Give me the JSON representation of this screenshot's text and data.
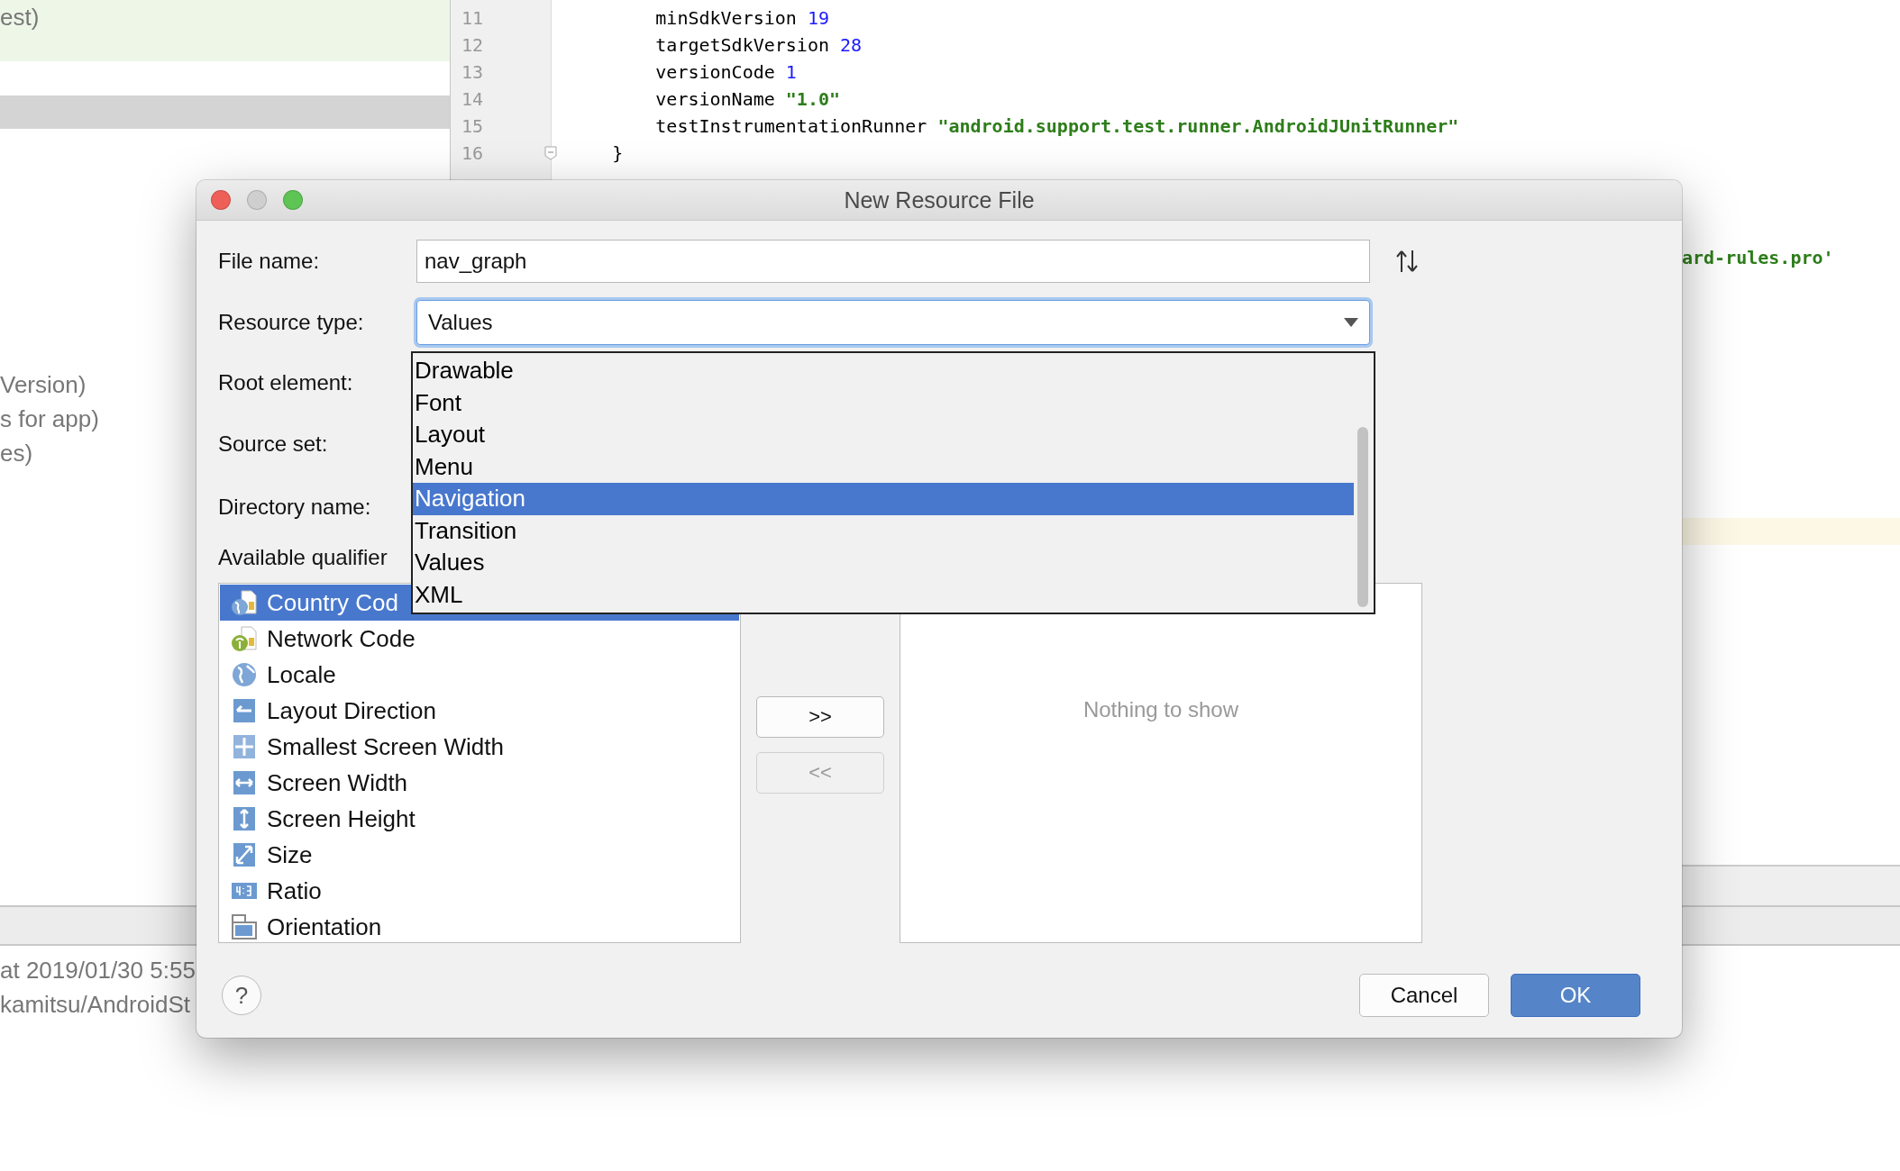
{
  "background": {
    "left_panel": {
      "highlighted_line": "est)",
      "lines": [
        "Version)",
        "s for app)",
        "es)"
      ],
      "status_lines": [
        "at 2019/01/30 5:55",
        "kamitsu/AndroidSt"
      ]
    },
    "editor": {
      "lines": [
        {
          "number": "11",
          "tokens": [
            {
              "text": "        minSdkVersion ",
              "kind": "plain"
            },
            {
              "text": "19",
              "kind": "number"
            }
          ]
        },
        {
          "number": "12",
          "tokens": [
            {
              "text": "        targetSdkVersion ",
              "kind": "plain"
            },
            {
              "text": "28",
              "kind": "number"
            }
          ]
        },
        {
          "number": "13",
          "tokens": [
            {
              "text": "        versionCode ",
              "kind": "plain"
            },
            {
              "text": "1",
              "kind": "number"
            }
          ]
        },
        {
          "number": "14",
          "tokens": [
            {
              "text": "        versionName ",
              "kind": "plain"
            },
            {
              "text": "\"1.0\"",
              "kind": "string"
            }
          ]
        },
        {
          "number": "15",
          "tokens": [
            {
              "text": "        testInstrumentationRunner ",
              "kind": "plain"
            },
            {
              "text": "\"android.support.test.runner.AndroidJUnitRunner\"",
              "kind": "string"
            }
          ]
        },
        {
          "number": "16",
          "fold_marker": true,
          "tokens": [
            {
              "text": "    }",
              "kind": "plain"
            }
          ]
        }
      ],
      "right_fragment": "ard-rules.pro'"
    }
  },
  "dialog": {
    "title": "New Resource File",
    "window_controls": [
      {
        "kind": "close",
        "enabled": true
      },
      {
        "kind": "minimize",
        "enabled": false
      },
      {
        "kind": "zoom",
        "enabled": true
      }
    ],
    "file_name": {
      "label": "File name:",
      "value": "nav_graph"
    },
    "resource_type": {
      "label": "Resource type:",
      "value": "Values",
      "expanded": true
    },
    "labels": [
      "Root element:",
      "Source set:",
      "Directory name:",
      "Available qualifier"
    ],
    "dropdown": {
      "items": [
        {
          "label": "Drawable",
          "selected": false
        },
        {
          "label": "Font",
          "selected": false
        },
        {
          "label": "Layout",
          "selected": false
        },
        {
          "label": "Menu",
          "selected": false
        },
        {
          "label": "Navigation",
          "selected": true
        },
        {
          "label": "Transition",
          "selected": false
        },
        {
          "label": "Values",
          "selected": false
        },
        {
          "label": "XML",
          "selected": false
        }
      ]
    },
    "qualifiers": [
      {
        "label": "Country Cod",
        "kind": "country",
        "selected": true
      },
      {
        "label": "Network Code",
        "kind": "network",
        "selected": false
      },
      {
        "label": "Locale",
        "kind": "locale",
        "selected": false
      },
      {
        "label": "Layout Direction",
        "kind": "direction",
        "selected": false
      },
      {
        "label": "Smallest Screen Width",
        "kind": "smallest",
        "selected": false
      },
      {
        "label": "Screen Width",
        "kind": "width",
        "selected": false
      },
      {
        "label": "Screen Height",
        "kind": "height",
        "selected": false
      },
      {
        "label": "Size",
        "kind": "size",
        "selected": false
      },
      {
        "label": "Ratio",
        "kind": "ratio",
        "selected": false
      },
      {
        "label": "Orientation",
        "kind": "orientation",
        "selected": false
      }
    ],
    "move_buttons": [
      {
        "label": ">>",
        "enabled": true
      },
      {
        "label": "<<",
        "enabled": false
      }
    ],
    "chosen_empty_text": "Nothing to show",
    "help": "?",
    "footer_buttons": [
      {
        "label": "Cancel",
        "default": false
      },
      {
        "label": "OK",
        "default": true
      }
    ]
  }
}
